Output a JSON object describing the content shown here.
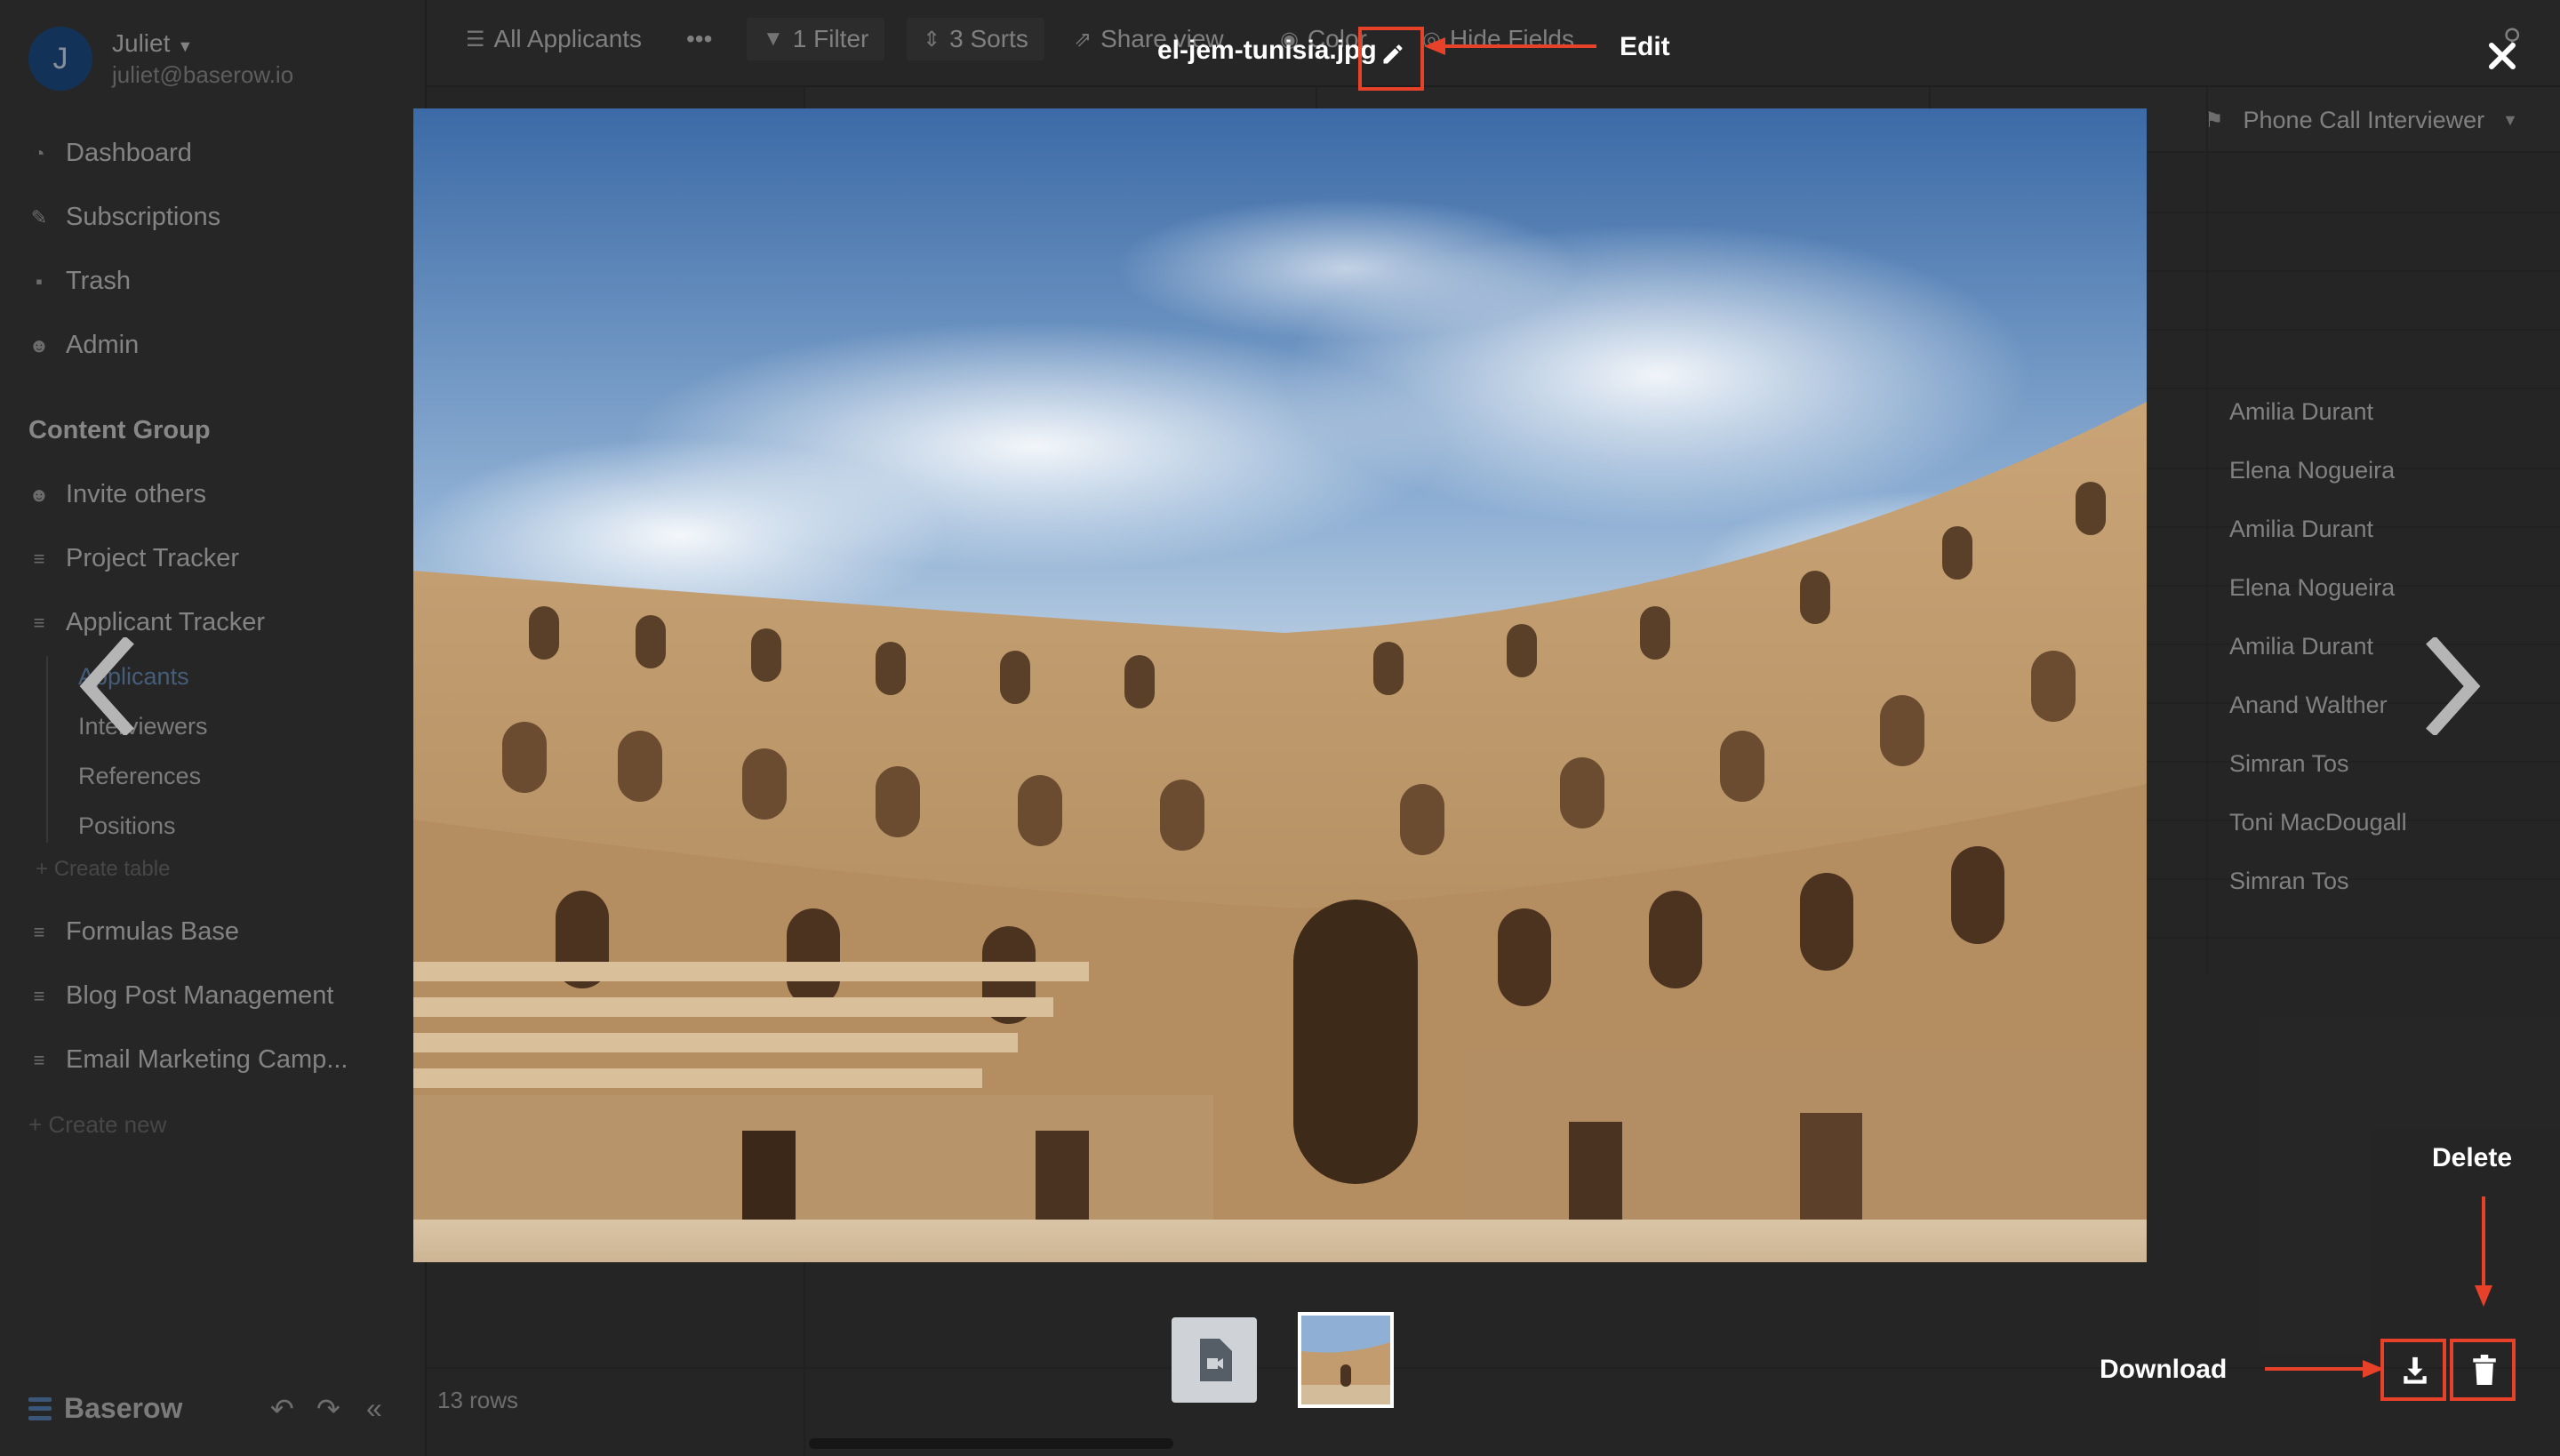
{
  "sidebar": {
    "user": {
      "initial": "J",
      "name": "Juliet",
      "email": "juliet@baserow.io"
    },
    "nav": [
      {
        "label": "Dashboard",
        "icon": "dashboard-icon"
      },
      {
        "label": "Subscriptions",
        "icon": "subscriptions-icon"
      },
      {
        "label": "Trash",
        "icon": "trash-icon"
      },
      {
        "label": "Admin",
        "icon": "users-icon"
      }
    ],
    "group_title": "Content Group",
    "invite": "Invite others",
    "databases": [
      "Project Tracker",
      "Applicant Tracker"
    ],
    "tables": [
      "Applicants",
      "Interviewers",
      "References",
      "Positions"
    ],
    "create_table": "Create table",
    "more_databases": [
      "Formulas Base",
      "Blog Post Management",
      "Email Marketing Camp..."
    ],
    "create_new": "Create new",
    "brand": "Baserow"
  },
  "toolbar": {
    "view": "All Applicants",
    "more": "•••",
    "filter": "1 Filter",
    "sorts": "3 Sorts",
    "share": "Share view",
    "color": "Color",
    "hide": "Hide Fields"
  },
  "grid": {
    "phone_header": "Phone Call Interviewer",
    "cells": [
      "Amilia Durant",
      "Elena Nogueira",
      "Amilia Durant",
      "Elena Nogueira",
      "Amilia Durant",
      "Anand Walther",
      "Simran Tos",
      "Toni MacDougall",
      "Simran Tos"
    ],
    "row_count": "13 rows"
  },
  "preview": {
    "filename": "el-jem-tunisia.jpg"
  },
  "annotations": {
    "edit": "Edit",
    "delete": "Delete",
    "download": "Download",
    "color": "#e8412a"
  }
}
